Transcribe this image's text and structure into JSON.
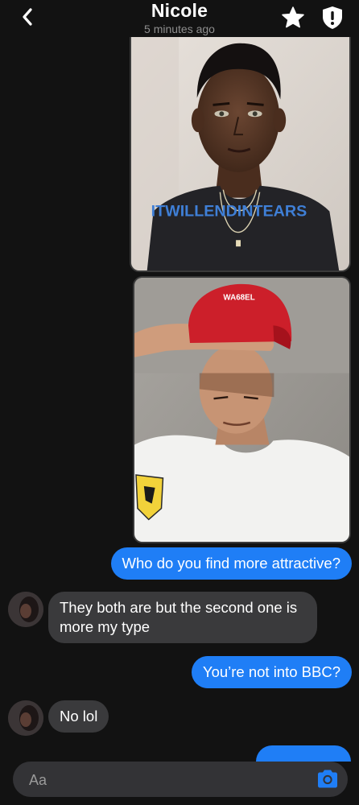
{
  "header": {
    "title": "Nicole",
    "subtitle": "5 minutes ago",
    "icons": {
      "back": "chevron-left-icon",
      "favorite": "star-icon",
      "safety": "shield-icon"
    }
  },
  "photos": [
    {
      "description_icon": "photo-portrait-man-black-sweater",
      "shirt_text": "ITWILLENDINTEARS"
    },
    {
      "description_icon": "photo-man-red-cap-white-shirt",
      "cap_text": "WA68EL"
    }
  ],
  "messages": [
    {
      "direction": "outgoing",
      "text": "Who do you find more attractive?"
    },
    {
      "direction": "incoming",
      "text": "They both are but the second one is more my type"
    },
    {
      "direction": "outgoing",
      "text": "You’re not into BBC?"
    },
    {
      "direction": "incoming",
      "text": "No lol"
    }
  ],
  "composer": {
    "placeholder": "Aa",
    "camera_icon": "camera-icon"
  },
  "colors": {
    "background": "#121212",
    "outgoing_bubble": "#1f7ef6",
    "incoming_bubble": "#3a3a3c",
    "composer": "#333336"
  }
}
